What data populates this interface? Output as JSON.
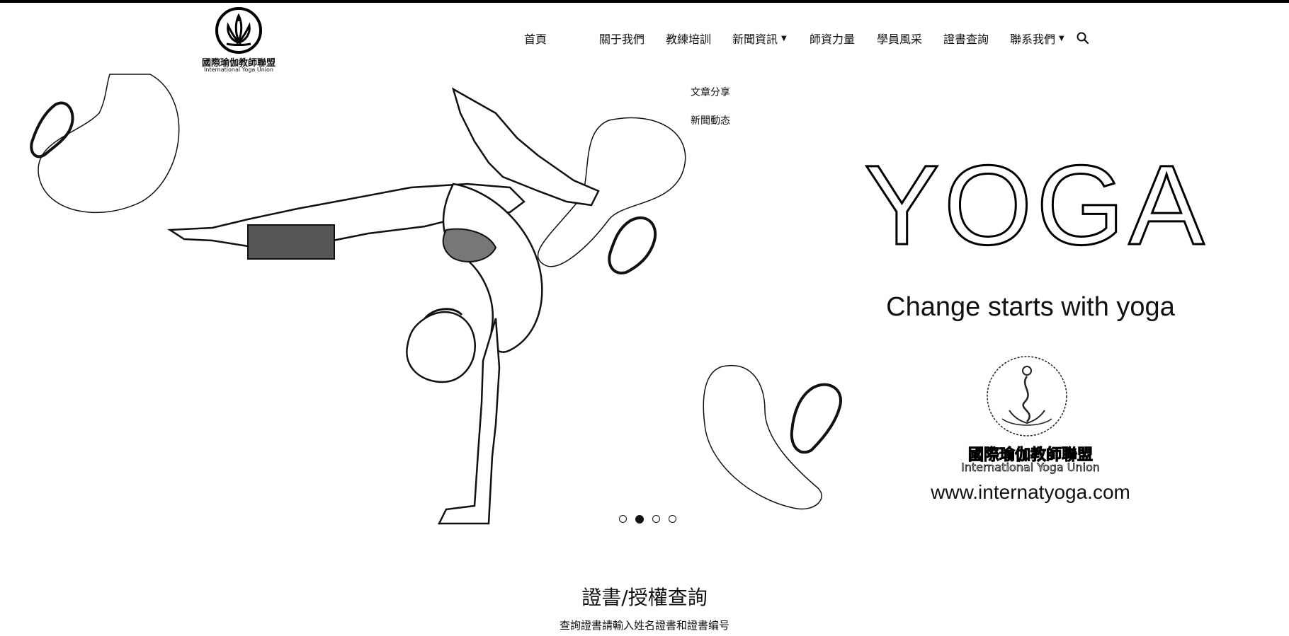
{
  "brand": {
    "logo_text_cn": "國際瑜伽教師聯盟",
    "logo_text_en": "International Yoga Union"
  },
  "nav": {
    "items": [
      {
        "label": "首頁",
        "has_dropdown": false
      },
      {
        "label": "關于我們",
        "has_dropdown": false
      },
      {
        "label": "教練培訓",
        "has_dropdown": false
      },
      {
        "label": "新聞資訊",
        "has_dropdown": true
      },
      {
        "label": "師資力量",
        "has_dropdown": false
      },
      {
        "label": "學員風采",
        "has_dropdown": false
      },
      {
        "label": "證書查詢",
        "has_dropdown": false
      },
      {
        "label": "聯系我們",
        "has_dropdown": true
      }
    ],
    "search_icon": "search-icon",
    "dropdown_news": [
      "文章分享",
      "新聞動态"
    ]
  },
  "hero": {
    "title": "YOGA",
    "subtitle": "Change starts with yoga",
    "emblem_cn": "國際瑜伽教師聯盟",
    "emblem_en": "International Yoga Union",
    "website": "www.internatyoga.com",
    "slides_total": 4,
    "active_slide": 2
  },
  "cert": {
    "title": "證書/授權查詢",
    "description": "查詢證書請輸入姓名證書和證書编号"
  }
}
